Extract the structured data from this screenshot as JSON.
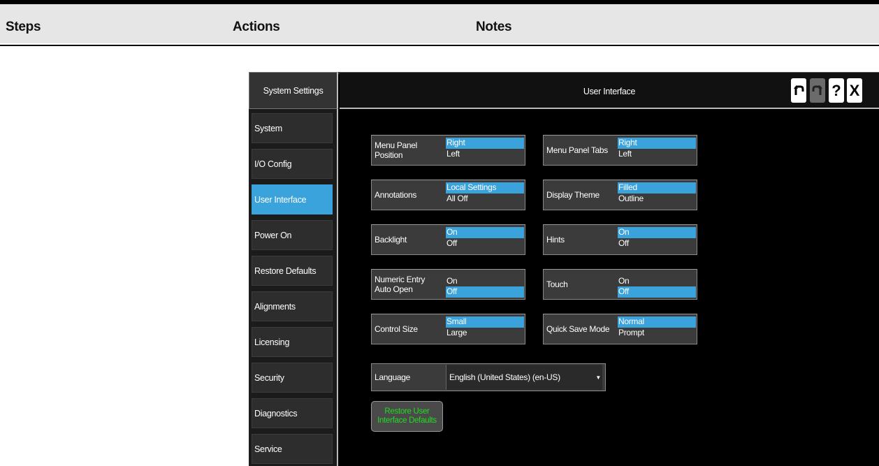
{
  "doc_header": {
    "steps": "Steps",
    "actions": "Actions",
    "notes": "Notes"
  },
  "sidebar": {
    "title": "System Settings",
    "items": [
      {
        "label": "System",
        "active": false
      },
      {
        "label": "I/O Config",
        "active": false
      },
      {
        "label": "User Interface",
        "active": true
      },
      {
        "label": "Power On",
        "active": false
      },
      {
        "label": "Restore Defaults",
        "active": false
      },
      {
        "label": "Alignments",
        "active": false
      },
      {
        "label": "Licensing",
        "active": false
      },
      {
        "label": "Security",
        "active": false
      },
      {
        "label": "Diagnostics",
        "active": false
      },
      {
        "label": "Service",
        "active": false
      }
    ]
  },
  "main": {
    "title": "User Interface",
    "toolbar": {
      "undo_icon": "undo-icon",
      "redo_icon": "redo-icon",
      "help_label": "?",
      "close_label": "X"
    },
    "settings": [
      {
        "label": "Menu Panel Position",
        "options": [
          "Right",
          "Left"
        ],
        "selected": "Right"
      },
      {
        "label": "Menu Panel Tabs",
        "options": [
          "Right",
          "Left"
        ],
        "selected": "Right"
      },
      {
        "label": "Annotations",
        "options": [
          "Local Settings",
          "All Off"
        ],
        "selected": "Local Settings"
      },
      {
        "label": "Display Theme",
        "options": [
          "Filled",
          "Outline"
        ],
        "selected": "Filled"
      },
      {
        "label": "Backlight",
        "options": [
          "On",
          "Off"
        ],
        "selected": "On"
      },
      {
        "label": "Hints",
        "options": [
          "On",
          "Off"
        ],
        "selected": "On"
      },
      {
        "label": "Numeric Entry\nAuto Open",
        "options": [
          "On",
          "Off"
        ],
        "selected": "Off"
      },
      {
        "label": "Touch",
        "options": [
          "On",
          "Off"
        ],
        "selected": "Off"
      },
      {
        "label": "Control Size",
        "options": [
          "Small",
          "Large"
        ],
        "selected": "Small"
      },
      {
        "label": "Quick Save Mode",
        "options": [
          "Normal",
          "Prompt"
        ],
        "selected": "Normal"
      }
    ],
    "language": {
      "label": "Language",
      "value": "English (United States) (en-US)"
    },
    "restore_button": "Restore User Interface Defaults"
  },
  "colors": {
    "accent": "#3aa3dc",
    "restore_text": "#20dd20",
    "panel_bg": "#000000"
  }
}
